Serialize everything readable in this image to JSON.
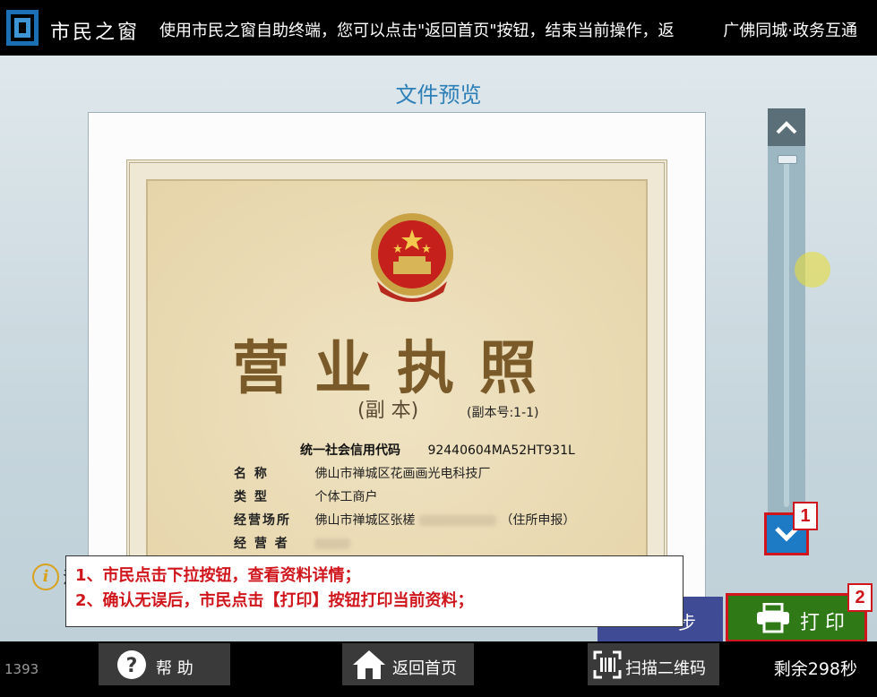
{
  "header": {
    "app_name": "市民之窗",
    "marquee": "使用市民之窗自助终端，您可以点击\"返回首页\"按钮，结束当前操作，返",
    "region": "广佛同城·政务互通"
  },
  "preview": {
    "title": "文件预览",
    "document": {
      "title": "营业执照",
      "copy_label": "(副  本)",
      "copy_no": "(副本号:1-1)",
      "credit_label": "统一社会信用代码",
      "credit_code": "92440604MA52HT931L",
      "fields": [
        {
          "label": "名      称",
          "value": "佛山市禅城区花画画光电科技厂"
        },
        {
          "label": "类      型",
          "value": "个体工商户"
        },
        {
          "label": "经营场所",
          "value": "佛山市禅城区张槎",
          "suffix": "（住所申报）"
        },
        {
          "label": "经  营  者",
          "value": ""
        }
      ]
    }
  },
  "annotations": {
    "callout_1": "1",
    "callout_2": "2",
    "lines": [
      "1、市民点击下拉按钮，查看资料详情；",
      "2、确认无误后，市民点击【打印】按钮打印当前资料；"
    ],
    "info_text": "注"
  },
  "buttons": {
    "prev": "步",
    "print": "打印"
  },
  "footer": {
    "terminal_id": "1393",
    "help": "帮  助",
    "home": "返回首页",
    "scan": "扫描二维码",
    "remaining": "剩余298秒"
  },
  "colors": {
    "accent_blue": "#1c7bc4",
    "print_green": "#2f7a17",
    "annotation_red": "#d0161c",
    "title_blue": "#2d7fb8"
  }
}
